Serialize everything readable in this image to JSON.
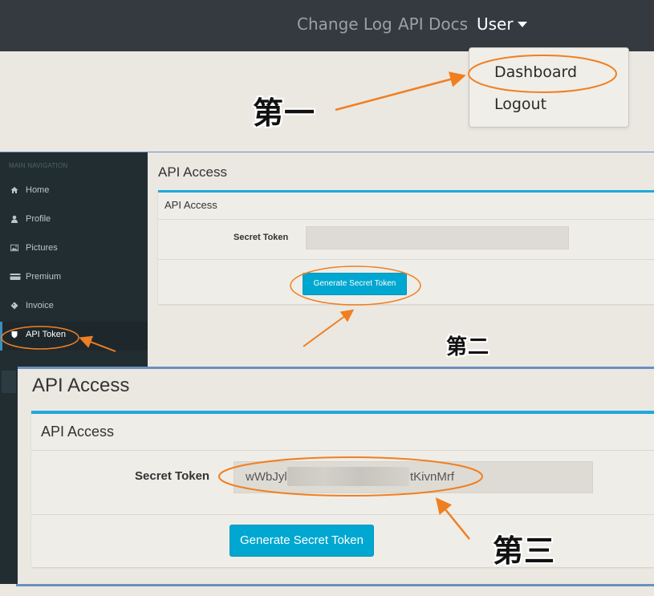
{
  "top_nav": {
    "links": [
      "Change Log",
      "API Docs"
    ],
    "user_label": "User",
    "dropdown": [
      "Dashboard",
      "Logout"
    ]
  },
  "annotation_labels": [
    "第一",
    "第二",
    "第三"
  ],
  "sidebar": {
    "header": "MAIN NAVIGATION",
    "items": [
      {
        "label": "Home",
        "icon": "home-icon"
      },
      {
        "label": "Profile",
        "icon": "user-icon"
      },
      {
        "label": "Pictures",
        "icon": "picture-icon"
      },
      {
        "label": "Premium",
        "icon": "credit-card-icon"
      },
      {
        "label": "Invoice",
        "icon": "tag-icon"
      },
      {
        "label": "API Token",
        "icon": "shield-icon",
        "active": true
      }
    ]
  },
  "api_page": {
    "page_title": "API Access",
    "box_title": "API Access",
    "token_label": "Secret Token",
    "token_value_start": "wWbJyl",
    "token_value_end": "tKivnMrf",
    "generate_button": "Generate Secret Token"
  },
  "colors": {
    "accent": "#1fa8dd",
    "button": "#00a7d0",
    "annotation": "#f07f22",
    "sidebar_bg": "#222d32",
    "topbar_bg": "#343a3f"
  }
}
